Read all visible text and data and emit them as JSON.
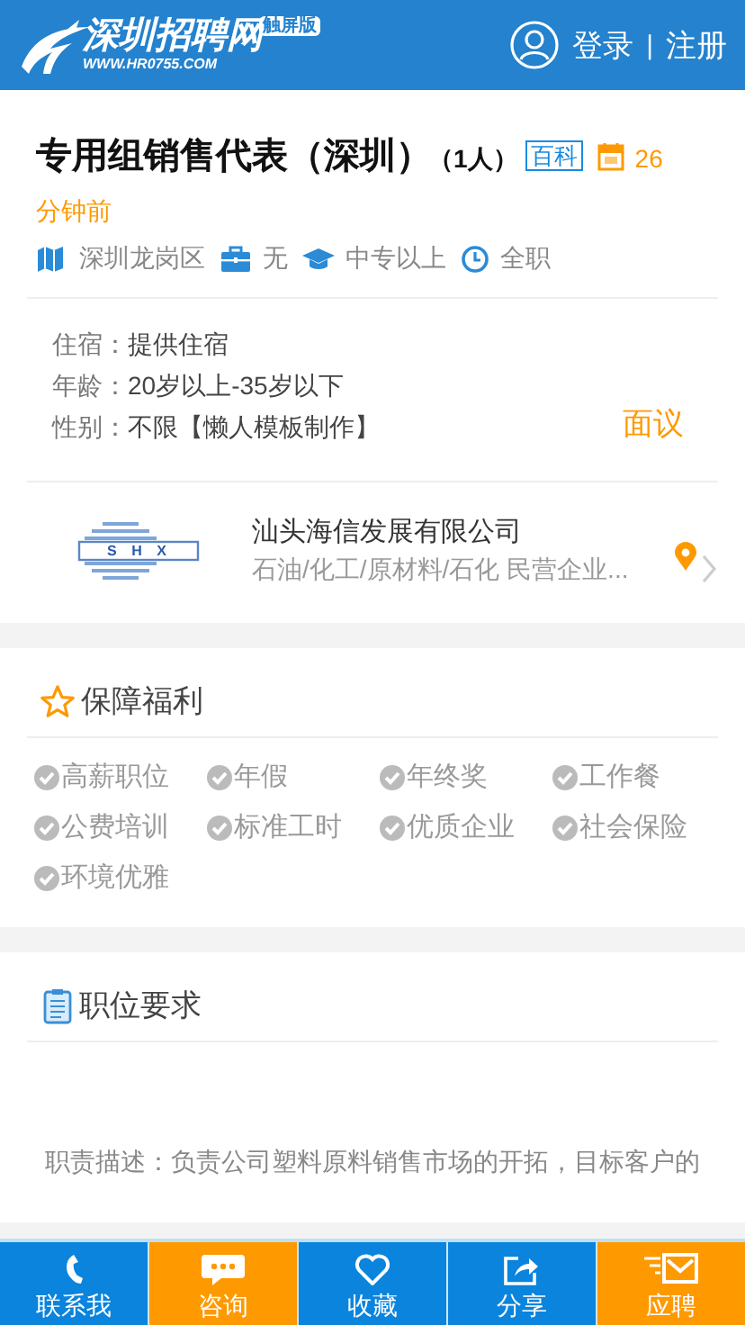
{
  "header": {
    "logo": {
      "name": "深圳招聘网",
      "badge": "触屏版",
      "url": "WWW.HR0755.COM"
    },
    "login": "登录",
    "separator": "|",
    "register": "注册"
  },
  "job": {
    "title": "专用组销售代表（深圳）",
    "headcount": "（1人）",
    "wiki": "百科",
    "posted": {
      "number": "26",
      "unit": "分钟前"
    },
    "meta": [
      {
        "kind": "location",
        "text": "深圳龙岗区"
      },
      {
        "kind": "experience",
        "text": "无"
      },
      {
        "kind": "education",
        "text": "中专以上"
      },
      {
        "kind": "type",
        "text": "全职"
      }
    ],
    "details": [
      {
        "label": "住宿：",
        "value": "提供住宿"
      },
      {
        "label": "年龄：",
        "value": "20岁以上-35岁以下"
      },
      {
        "label": "性别：",
        "value": "不限【懒人模板制作】"
      }
    ],
    "salary": "面议"
  },
  "company": {
    "logo_text": "S H X",
    "name": "汕头海信发展有限公司",
    "info": "石油/化工/原材料/石化 民营企业..."
  },
  "welfare": {
    "title": "保障福利",
    "items": [
      "高薪职位",
      "年假",
      "年终奖",
      "工作餐",
      "公费培训",
      "标准工时",
      "优质企业",
      "社会保险",
      "环境优雅"
    ]
  },
  "requirements": {
    "title": "职位要求",
    "description": "职责描述：负责公司塑料原料销售市场的开拓，目标客户的"
  },
  "bottom_bar": [
    {
      "kind": "phone",
      "label": "联系我",
      "color": "#0a84dc"
    },
    {
      "kind": "chat",
      "label": "咨询",
      "color": "#ff9900"
    },
    {
      "kind": "heart",
      "label": "收藏",
      "color": "#0a84dc"
    },
    {
      "kind": "share",
      "label": "分享",
      "color": "#0a84dc"
    },
    {
      "kind": "mail",
      "label": "应聘",
      "color": "#ff9900"
    }
  ]
}
